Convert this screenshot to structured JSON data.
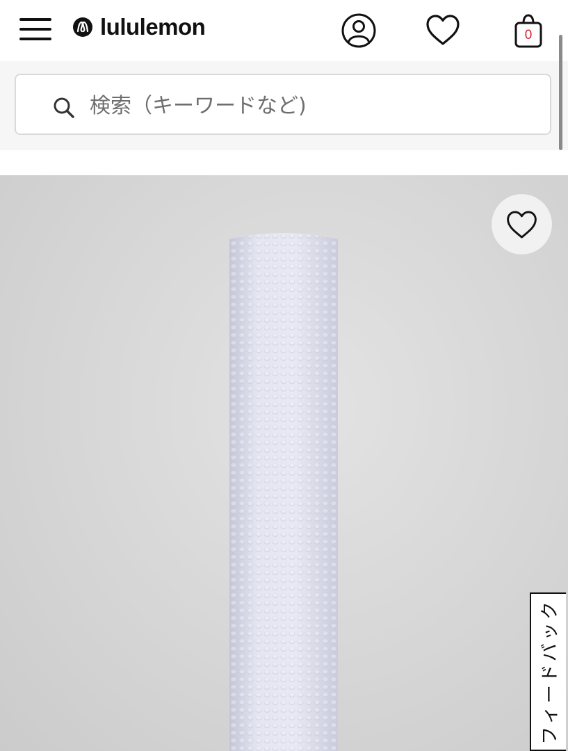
{
  "header": {
    "brand": "lululemon",
    "menu_icon": "hamburger-menu-icon",
    "account_icon": "account-icon",
    "wishlist_icon": "heart-icon",
    "bag_icon": "shopping-bag-icon",
    "bag_count": "0"
  },
  "search": {
    "placeholder": "検索（キーワードなど)",
    "icon": "search-icon"
  },
  "product": {
    "wishlist_icon": "heart-icon"
  },
  "feedback": {
    "label": "フィードバック"
  },
  "colors": {
    "text": "#111111",
    "bag_count": "#d22030",
    "search_band": "#f6f6f6",
    "roller": "#dfe0ec"
  }
}
